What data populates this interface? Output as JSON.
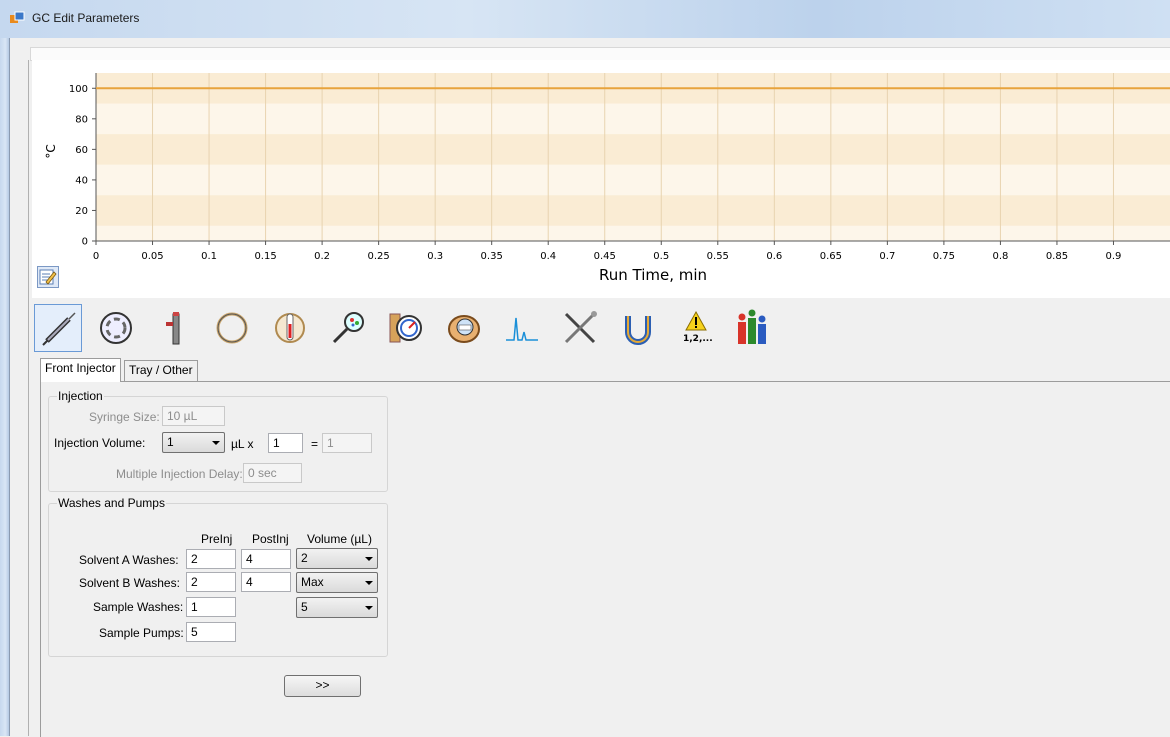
{
  "window": {
    "title": "GC Edit Parameters"
  },
  "chart_data": {
    "type": "line",
    "xlabel": "Run Time, min",
    "ylabel": "°C",
    "x_ticks": [
      "0",
      "0.05",
      "0.1",
      "0.15",
      "0.2",
      "0.25",
      "0.3",
      "0.35",
      "0.4",
      "0.45",
      "0.5",
      "0.55",
      "0.6",
      "0.65",
      "0.7",
      "0.75",
      "0.8",
      "0.85",
      "0.9"
    ],
    "y_ticks": [
      "0",
      "20",
      "40",
      "60",
      "80",
      "100"
    ],
    "xlim": [
      0,
      0.95
    ],
    "ylim": [
      0,
      110
    ],
    "series": [
      {
        "x": [
          0,
          0.95
        ],
        "values": [
          100,
          100
        ],
        "color": "#e8a33c"
      }
    ],
    "grid": true
  },
  "toolbar": {
    "items": [
      {
        "name": "injector-syringe-icon",
        "active": true
      },
      {
        "name": "inlet-icon"
      },
      {
        "name": "column-connector-icon"
      },
      {
        "name": "column-icon"
      },
      {
        "name": "oven-icon"
      },
      {
        "name": "detector-probe-icon"
      },
      {
        "name": "pressure-gauge-icon"
      },
      {
        "name": "timer-icon"
      },
      {
        "name": "signal-icon"
      },
      {
        "name": "tools-icon"
      },
      {
        "name": "valve-icon"
      },
      {
        "name": "warning-sequence-icon"
      },
      {
        "name": "chart-people-icon"
      }
    ],
    "warning_label": "1,2,..."
  },
  "tabs": [
    {
      "label": "Front Injector",
      "selected": true
    },
    {
      "label": "Tray / Other",
      "selected": false
    }
  ],
  "injection": {
    "title": "Injection",
    "syringe_size_label": "Syringe Size:",
    "syringe_size": "10 µL",
    "injection_volume_label": "Injection Volume:",
    "injection_volume": "1",
    "unit_x": "µL x",
    "multiplier": "1",
    "equals": "=",
    "total": "1",
    "delay_label": "Multiple Injection Delay:",
    "delay": "0 sec"
  },
  "washes": {
    "title": "Washes and Pumps",
    "col_preinj": "PreInj",
    "col_postinj": "PostInj",
    "col_volume": "Volume (µL)",
    "rows": [
      {
        "label": "Solvent A Washes:",
        "pre": "2",
        "post": "4",
        "volume": "2"
      },
      {
        "label": "Solvent B Washes:",
        "pre": "2",
        "post": "4",
        "volume": "Max"
      },
      {
        "label": "Sample Washes:",
        "pre": "1",
        "volume": "5"
      },
      {
        "label": "Sample Pumps:",
        "pre": "5"
      }
    ],
    "more_button": ">>"
  }
}
